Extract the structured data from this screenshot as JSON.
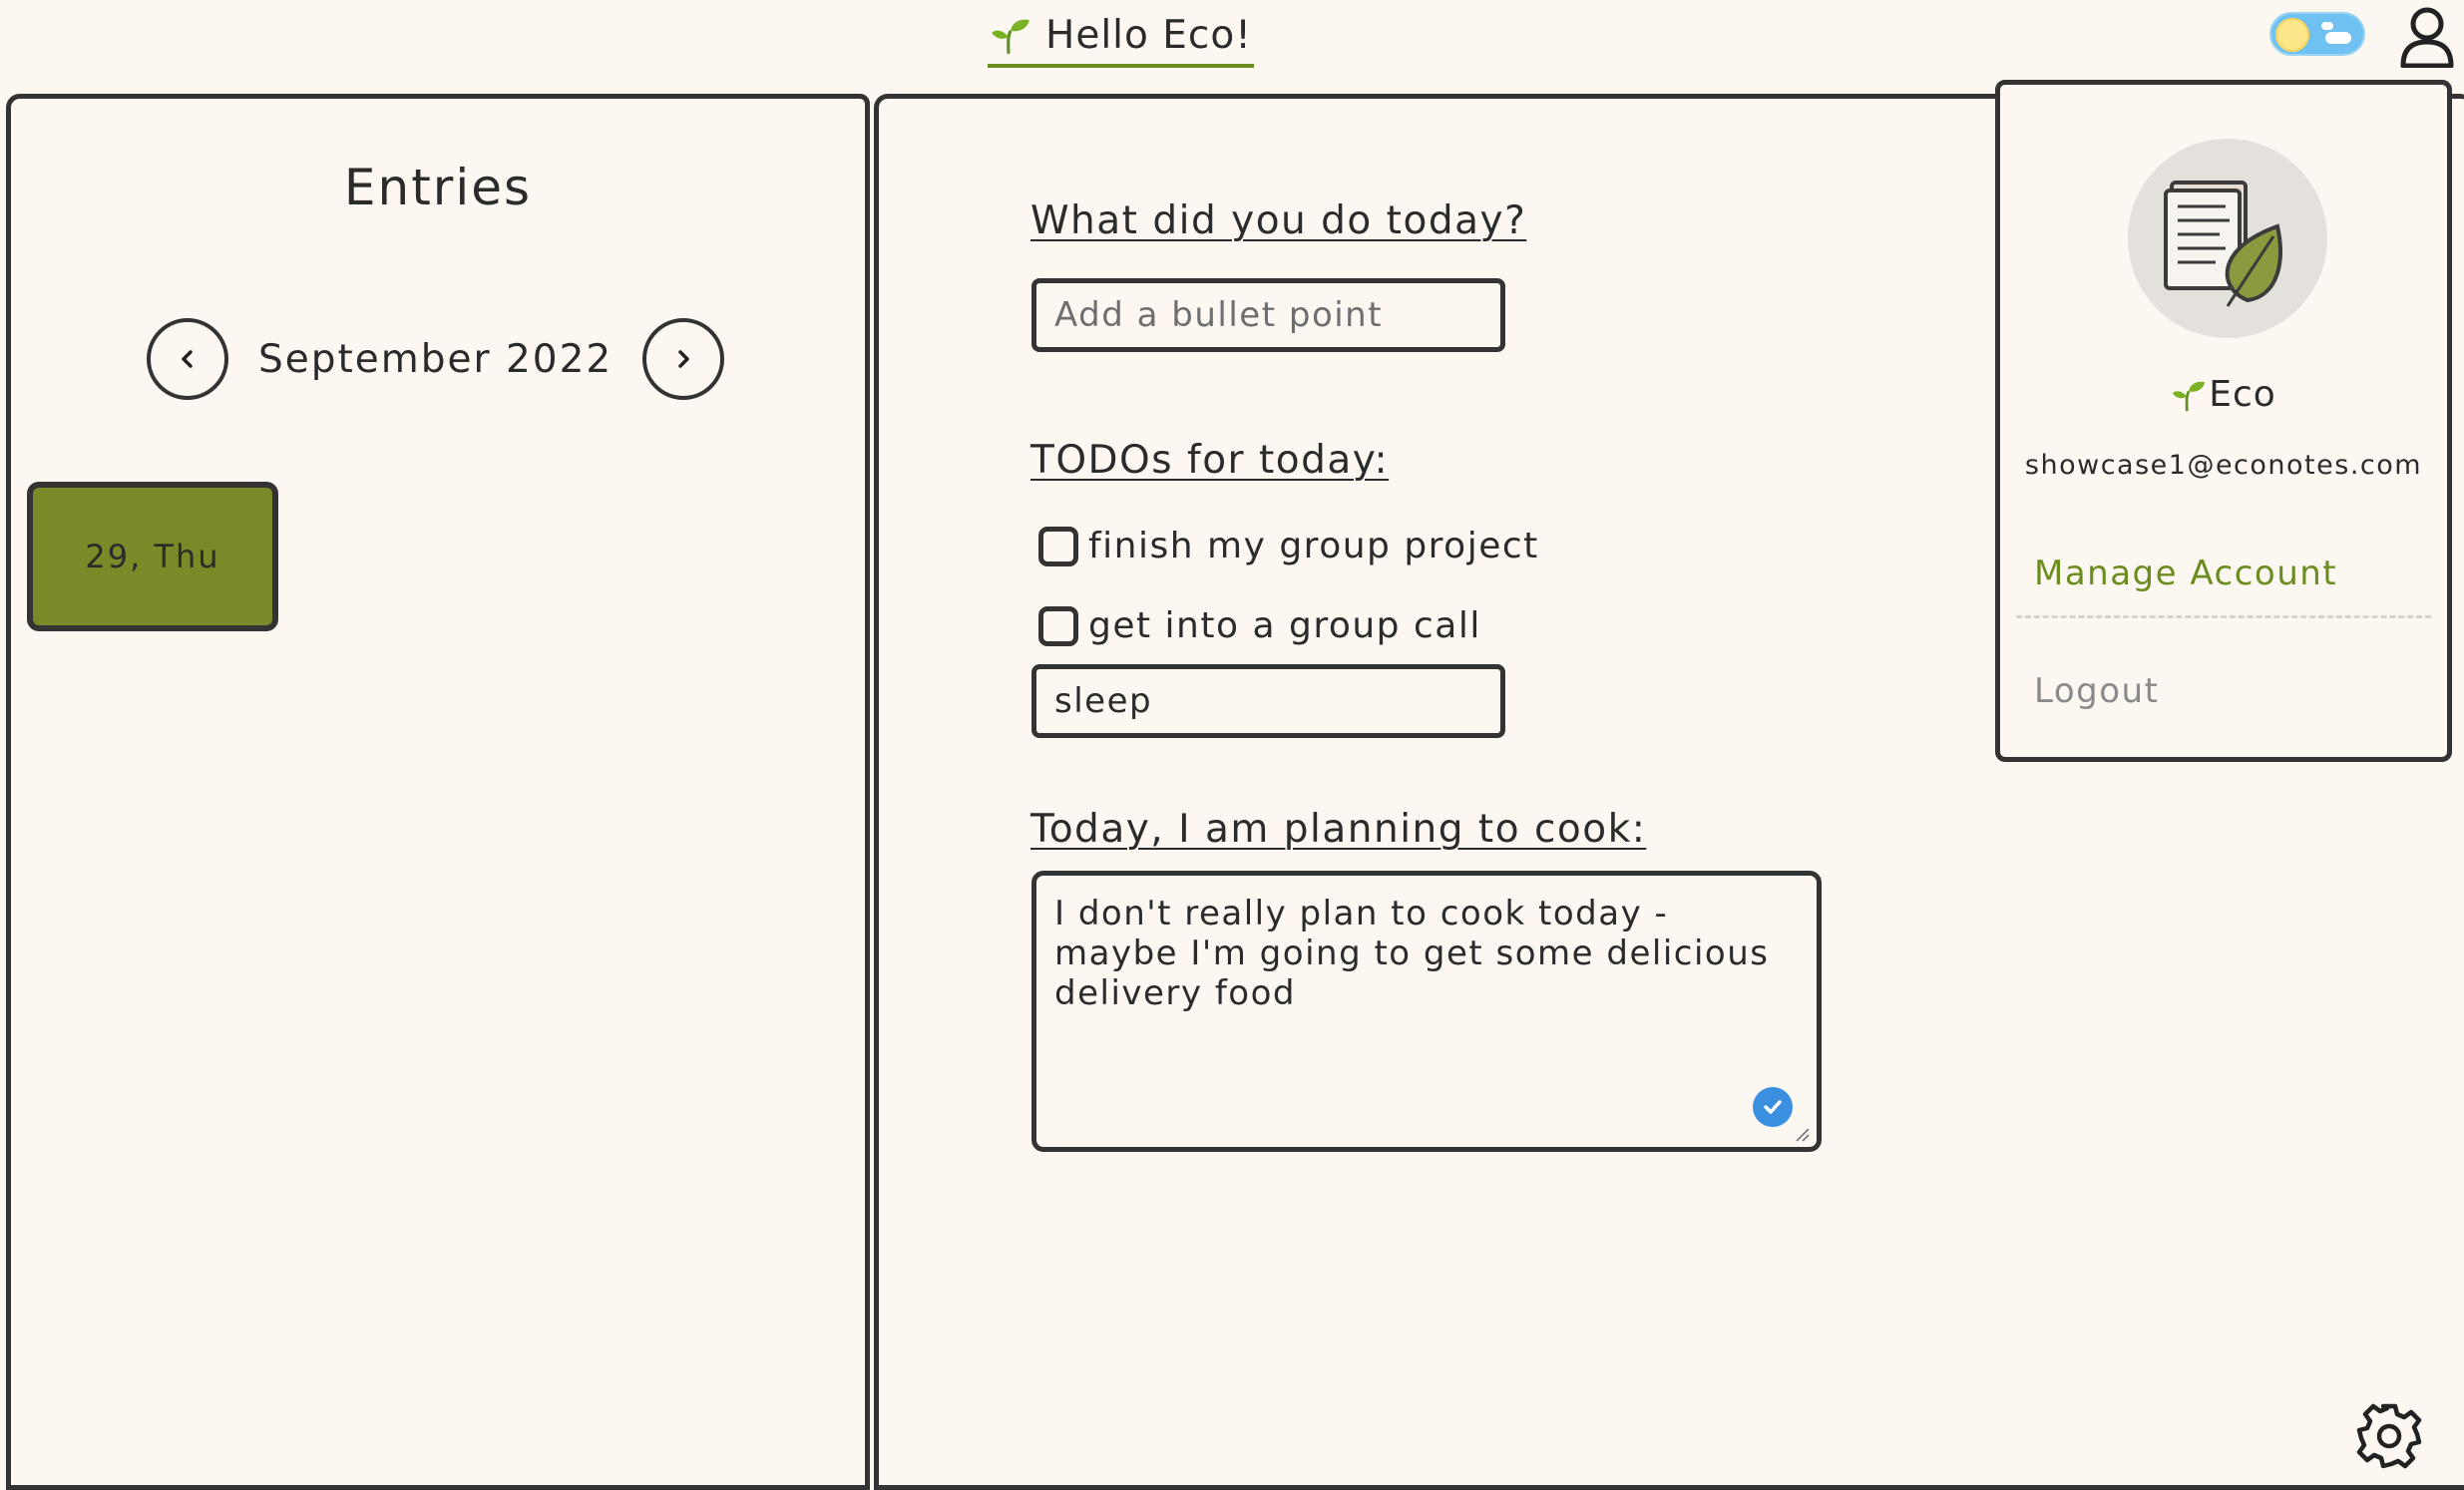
{
  "header": {
    "greeting": "Hello Eco!",
    "theme_toggle_icon": "sun-cloud-toggle-icon",
    "user_icon": "user-icon",
    "accent_color": "#6b8d1f"
  },
  "entries_panel": {
    "title": "Entries",
    "month": "September 2022",
    "prev_icon": "chevron-left-icon",
    "next_icon": "chevron-right-icon",
    "entries": [
      {
        "label": "29, Thu",
        "color": "#7b8928"
      }
    ]
  },
  "journal": {
    "done_title": "What did you do today?",
    "done_placeholder": "Add a bullet point",
    "todos_title": "TODOs for today:",
    "todos": [
      {
        "label": "finish my group project",
        "checked": false
      },
      {
        "label": "get into a group call",
        "checked": false
      }
    ],
    "todo_input_value": "sleep",
    "cook_title": "Today, I am planning to cook:",
    "cook_text": "I don't really plan to cook today - maybe I'm going to get some delicious delivery food"
  },
  "profile_menu": {
    "name": "Eco",
    "email": "showcase1@econotes.com",
    "manage_label": "Manage Account",
    "logout_label": "Logout",
    "manage_color": "#6b8d1f"
  },
  "footer": {
    "settings_icon": "gear-icon"
  }
}
